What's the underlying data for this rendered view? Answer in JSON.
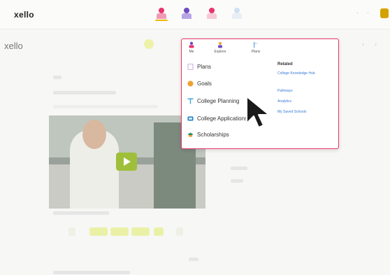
{
  "app": {
    "brand": "xello",
    "subbrand": "xello"
  },
  "topbar": {
    "right_items": [
      "·",
      "·"
    ],
    "icon_colors": [
      "#e8336f",
      "#6b4cc2",
      "#e8336f",
      "#6aa0d8"
    ]
  },
  "dropdown": {
    "tabs": [
      {
        "label": "Me",
        "icon": "person-icon"
      },
      {
        "label": "Explore",
        "icon": "compass-icon"
      },
      {
        "label": "Plans",
        "icon": "flag-icon"
      }
    ],
    "menu": [
      {
        "label": "Plans",
        "icon": "plans-icon",
        "color": "#d4b9e6"
      },
      {
        "label": "Goals",
        "icon": "goals-icon",
        "color": "#f0a030"
      },
      {
        "label": "College Planning",
        "icon": "college-planning-icon",
        "color": "#3fa9d4"
      },
      {
        "label": "College Applications",
        "icon": "college-applications-icon",
        "color": "#1e7fc7"
      },
      {
        "label": "Scholarships",
        "icon": "scholarships-icon",
        "color": "#2c8f6b"
      }
    ],
    "related": {
      "title": "Related",
      "links": [
        "College Knowledge Hub",
        "Pathways",
        "Analytics",
        "My Saved Schools"
      ]
    }
  },
  "colors": {
    "accent": "#e8336f",
    "link": "#3a7bd5",
    "play": "#9fbf3a"
  }
}
